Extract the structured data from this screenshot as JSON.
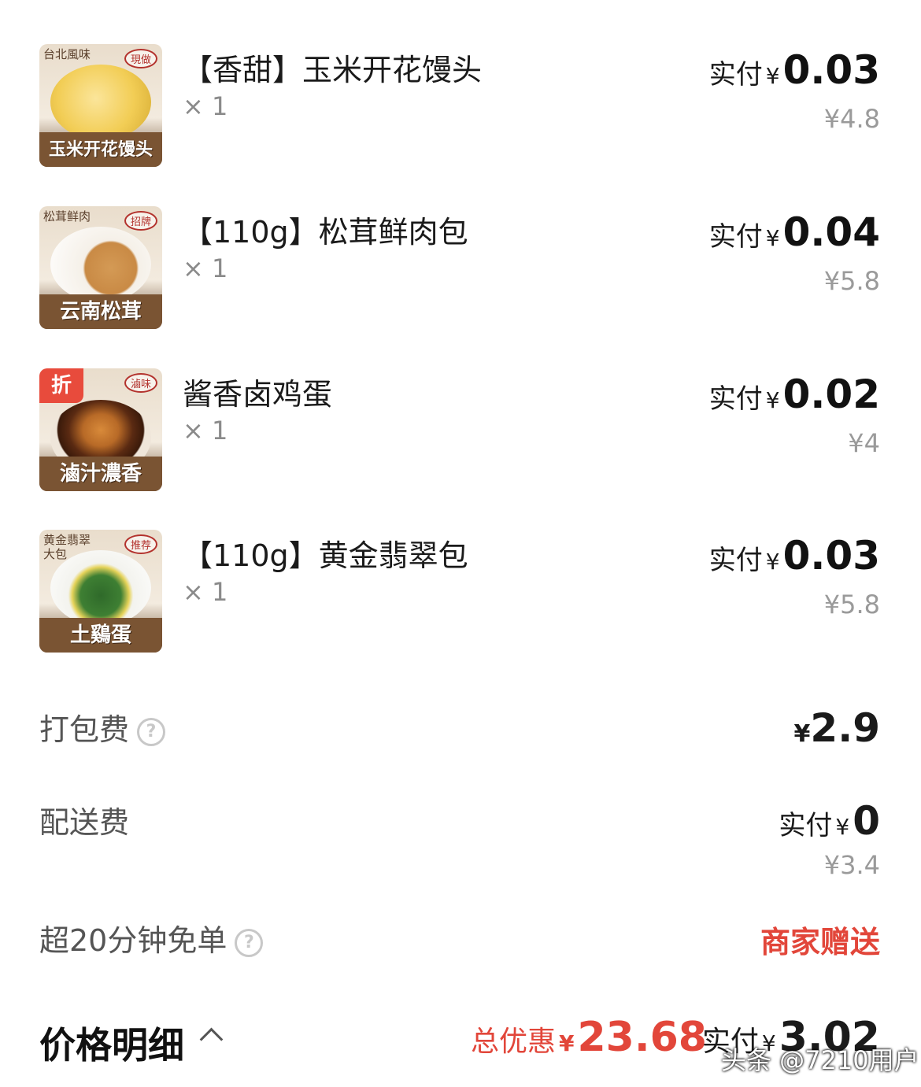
{
  "items": [
    {
      "title": "【香甜】玉米开花馒头",
      "qty": "× 1",
      "pay_label": "实付",
      "currency": "¥",
      "pay_value": "0.03",
      "original_price": "¥4.8",
      "thumb": {
        "corner_text": "台北風味",
        "stamp": "現做",
        "banner": "玉米开花馒头",
        "food_color": "#f2cd55"
      }
    },
    {
      "title": "【110g】松茸鲜肉包",
      "qty": "× 1",
      "pay_label": "实付",
      "currency": "¥",
      "pay_value": "0.04",
      "original_price": "¥5.8",
      "thumb": {
        "corner_text": "松茸鲜肉",
        "stamp": "招牌",
        "banner": "云南松茸",
        "food_color": "#d49a55"
      }
    },
    {
      "title": "酱香卤鸡蛋",
      "qty": "× 1",
      "pay_label": "实付",
      "currency": "¥",
      "pay_value": "0.02",
      "original_price": "¥4",
      "thumb": {
        "badge": "折",
        "stamp": "滷味",
        "banner": "滷汁濃香",
        "food_color": "#b86a27"
      }
    },
    {
      "title": "【110g】黄金翡翠包",
      "qty": "× 1",
      "pay_label": "实付",
      "currency": "¥",
      "pay_value": "0.03",
      "original_price": "¥5.8",
      "thumb": {
        "corner_text": "黄金翡翠大包",
        "stamp": "推荐",
        "banner": "土鷄蛋",
        "food_color": "#2f6a2a"
      }
    }
  ],
  "packing_fee": {
    "label": "打包费",
    "help": "?",
    "currency": "¥",
    "value": "2.9"
  },
  "delivery_fee": {
    "label": "配送费",
    "pay_label": "实付",
    "currency": "¥",
    "value": "0",
    "original_price": "¥3.4"
  },
  "free_order": {
    "label": "超20分钟免单",
    "help": "?",
    "value": "商家赠送"
  },
  "footer": {
    "title": "价格明细",
    "discount_label": "总优惠",
    "discount_currency": "¥",
    "discount_value": "23.68",
    "total_label": "实付",
    "total_currency": "¥",
    "total_value": "3.02"
  },
  "watermark": "头条 @7210用户"
}
